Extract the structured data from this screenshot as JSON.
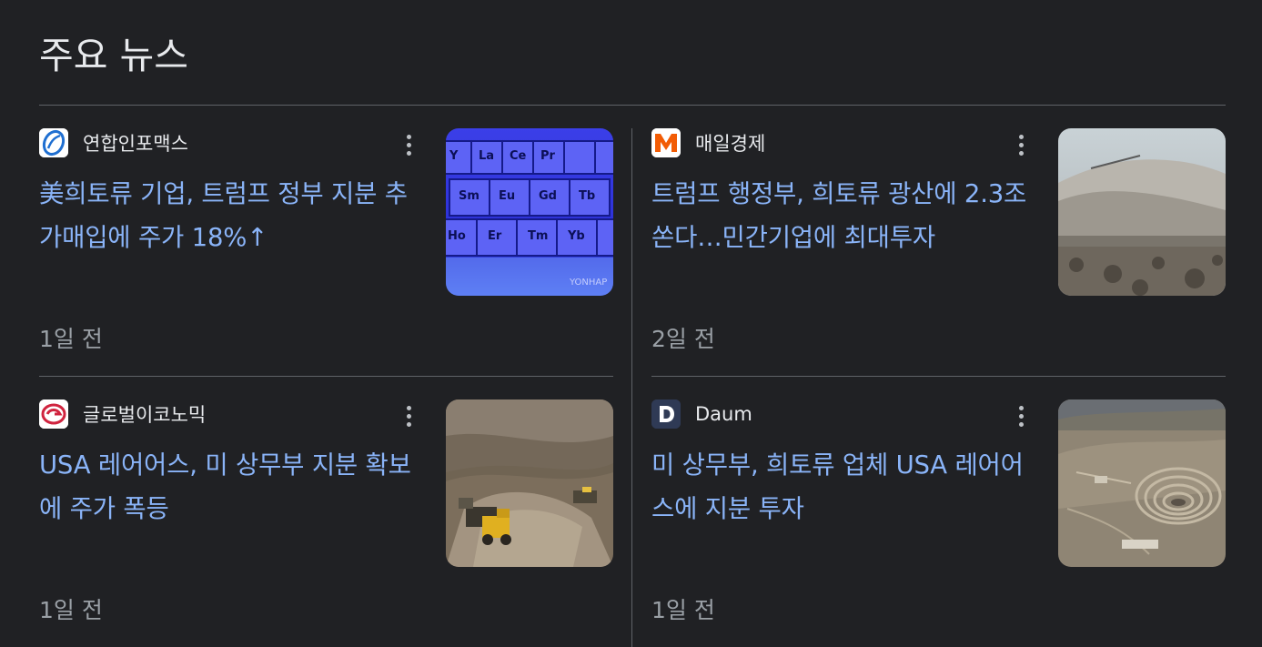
{
  "section": {
    "title": "주요 뉴스"
  },
  "articles": [
    {
      "source": "연합인포맥스",
      "headline": "美희토류 기업, 트럼프 정부 지분 추가매입에 주가 18%↑",
      "age": "1일 전",
      "logo_icon": "yonhap-infomax-logo",
      "thumbnail": "periodic-table-rare-earth-image",
      "thumbnail_watermark": "YONHAP"
    },
    {
      "source": "매일경제",
      "headline": "트럼프 행정부, 희토류 광산에 2.3조 쏜다…민간기업에 최대투자",
      "age": "2일 전",
      "logo_icon": "maeil-business-m-logo",
      "thumbnail": "mine-tailings-image"
    },
    {
      "source": "글로벌이코노믹",
      "headline": "USA 레어어스, 미 상무부 지분 확보에 주가 폭등",
      "age": "1일 전",
      "logo_icon": "global-economic-logo",
      "thumbnail": "mining-trucks-image"
    },
    {
      "source": "Daum",
      "headline": "미 상무부, 희토류 업체 USA 레어어스에 지분 투자",
      "age": "1일 전",
      "logo_icon": "daum-d-logo",
      "thumbnail": "open-pit-mine-image"
    }
  ],
  "colors": {
    "background": "#202124",
    "headline_link": "#8ab4f8",
    "text": "#e8eaed",
    "muted": "#9aa0a6",
    "divider": "#5f6368"
  }
}
